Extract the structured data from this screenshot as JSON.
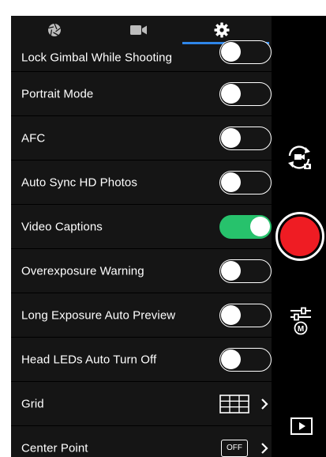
{
  "tabs": [
    {
      "name": "photo",
      "icon": "aperture-icon"
    },
    {
      "name": "video",
      "icon": "video-camera-icon"
    },
    {
      "name": "settings",
      "icon": "gear-icon",
      "active": true
    }
  ],
  "settings": [
    {
      "label": "Lock Gimbal While Shooting",
      "control": "toggle",
      "on": false
    },
    {
      "label": "Portrait Mode",
      "control": "toggle",
      "on": false
    },
    {
      "label": "AFC",
      "control": "toggle",
      "on": false
    },
    {
      "label": "Auto Sync HD Photos",
      "control": "toggle",
      "on": false
    },
    {
      "label": "Video Captions",
      "control": "toggle",
      "on": true
    },
    {
      "label": "Overexposure Warning",
      "control": "toggle",
      "on": false
    },
    {
      "label": "Long Exposure Auto Preview",
      "control": "toggle",
      "on": false
    },
    {
      "label": "Head LEDs Auto Turn Off",
      "control": "toggle",
      "on": false
    },
    {
      "label": "Grid",
      "control": "grid-submenu"
    },
    {
      "label": "Center Point",
      "control": "off-submenu",
      "value": "OFF"
    }
  ],
  "controls": {
    "switch_camera_icon": "camera-switch-icon",
    "shutter_icon": "record-shutter-icon",
    "parameters_icon": "sliders-m-icon",
    "playback_icon": "playback-icon"
  },
  "colors": {
    "accent": "#2f86e8",
    "toggle_on": "#27c26c",
    "shutter": "#ef1c23",
    "panel_bg": "#151515"
  }
}
